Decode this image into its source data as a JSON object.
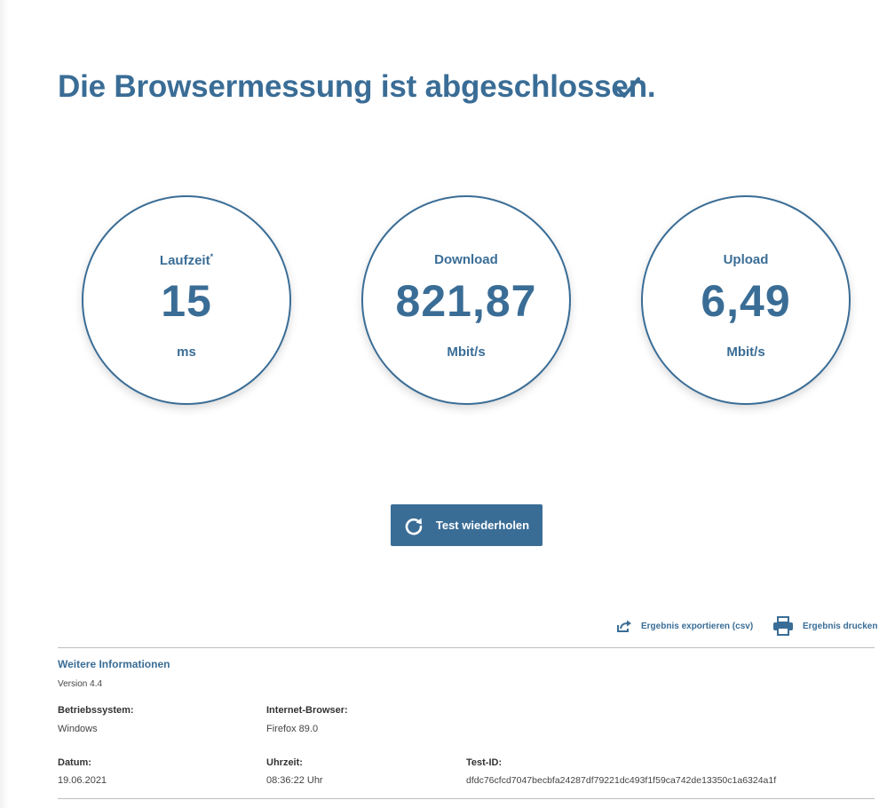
{
  "headline": "Die Browsermessung ist abgeschlossen.",
  "icons": {
    "check": "check-icon",
    "refresh": "refresh-icon",
    "export": "export-icon",
    "print": "printer-icon"
  },
  "colors": {
    "accent": "#3a6d96",
    "button_text": "#ffffff",
    "divider": "#bdbdbd"
  },
  "gauges": [
    {
      "label": "Laufzeit",
      "marker": "*",
      "value": "15",
      "unit": "ms"
    },
    {
      "label": "Download",
      "marker": "",
      "value": "821,87",
      "unit": "Mbit/s"
    },
    {
      "label": "Upload",
      "marker": "",
      "value": "6,49",
      "unit": "Mbit/s"
    }
  ],
  "repeat_button": {
    "label": "Test wiederholen"
  },
  "actions": {
    "export_label": "Ergebnis exportieren (csv)",
    "print_label": "Ergebnis drucken"
  },
  "info": {
    "title": "Weitere Informationen",
    "version": "Version 4.4",
    "os": {
      "label": "Betriebssystem:",
      "value": "Windows"
    },
    "browser": {
      "label": "Internet-Browser:",
      "value": "Firefox 89.0"
    },
    "date": {
      "label": "Datum:",
      "value": "19.06.2021"
    },
    "time": {
      "label": "Uhrzeit:",
      "value": "08:36:22 Uhr"
    },
    "test_id": {
      "label": "Test-ID:",
      "value": "dfdc76cfcd7047becbfa24287df79221dc493f1f59ca742de13350c1a6324a1f"
    }
  }
}
